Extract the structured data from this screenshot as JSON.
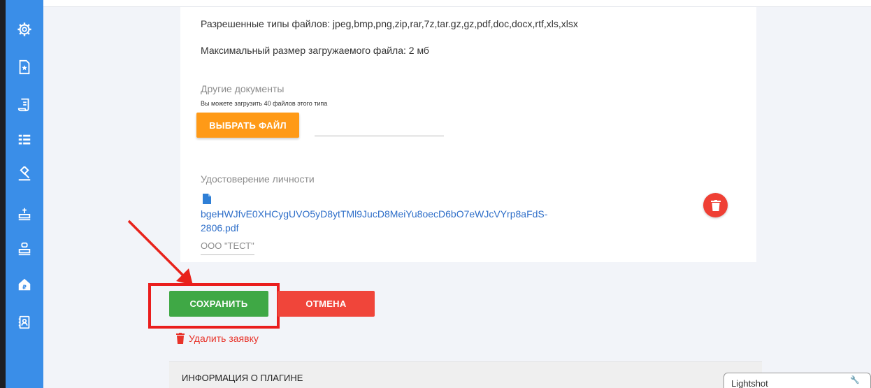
{
  "sidebar": {
    "icons": [
      "settings-icon",
      "document-star-icon",
      "scroll-document-icon",
      "list-tree-icon",
      "gavel-icon",
      "stamp-icon",
      "stamp-alt-icon",
      "ruble-building-icon",
      "contacts-book-icon"
    ]
  },
  "upload": {
    "allowed_types": "Разрешенные типы файлов: jpeg,bmp,png,zip,rar,7z,tar.gz,gz,pdf,doc,docx,rtf,xls,xlsx",
    "max_size": "Максимальный размер загружаемого файла: 2 мб",
    "other_docs_label": "Другие документы",
    "other_docs_hint": "Вы можете загрузить 40 файлов этого типа",
    "choose_file_button": "ВЫБРАТЬ ФАЙЛ",
    "id_label": "Удостоверение личности",
    "file_link_line1": "bgeHWJfvE0XHCygUVO5yD8ytTMl9JucD8MeiYu8oecD6bO7eWJcVYrp8aFdS-",
    "file_link_line2": "2806.pdf",
    "org_value": "ООО \"ТЕСТ\""
  },
  "actions": {
    "save_label": "СОХРАНИТЬ",
    "cancel_label": "ОТМЕНА",
    "delete_application_label": "Удалить заявку"
  },
  "info_panel": {
    "title": "ИНФОРМАЦИЯ О ПЛАГИНЕ"
  },
  "lightshot": {
    "label": "Lightshot"
  },
  "colors": {
    "sidebar": "#3a8ee8",
    "orange": "#ff9a17",
    "green": "#3fa845",
    "red": "#f0453a",
    "highlight": "#ea1d1d",
    "link": "#2f6fc9"
  }
}
